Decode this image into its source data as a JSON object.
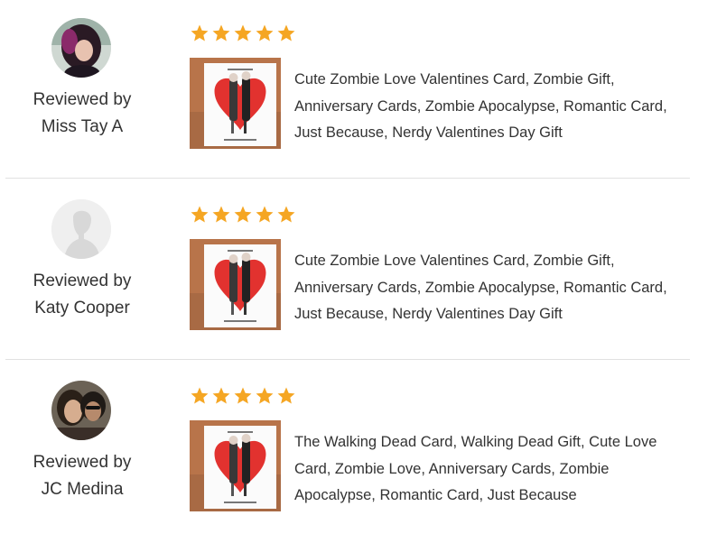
{
  "colors": {
    "star": "#f5a623",
    "divider": "#e1e1e1",
    "text": "#333333"
  },
  "reviews": [
    {
      "reviewed_by_label": "Reviewed by",
      "reviewer_name": "Miss Tay A",
      "rating": 5,
      "max_rating": 5,
      "avatar": "user-photo-avatar",
      "item_title": "Cute Zombie Love Valentines Card, Zombie Gift, Anniversary Cards, Zombie Apocalypse, Romantic Card, Just Because, Nerdy Valentines Day Gift"
    },
    {
      "reviewed_by_label": "Reviewed by",
      "reviewer_name": "Katy Cooper",
      "rating": 5,
      "max_rating": 5,
      "avatar": "default-user-silhouette-icon",
      "item_title": "Cute Zombie Love Valentines Card, Zombie Gift, Anniversary Cards, Zombie Apocalypse, Romantic Card, Just Because, Nerdy Valentines Day Gift"
    },
    {
      "reviewed_by_label": "Reviewed by",
      "reviewer_name": "JC Medina",
      "rating": 5,
      "max_rating": 5,
      "avatar": "user-photo-avatar",
      "item_title": "The Walking Dead Card, Walking Dead Gift, Cute Love Card, Zombie Love, Anniversary Cards, Zombie Apocalypse, Romantic Card, Just Because"
    }
  ]
}
